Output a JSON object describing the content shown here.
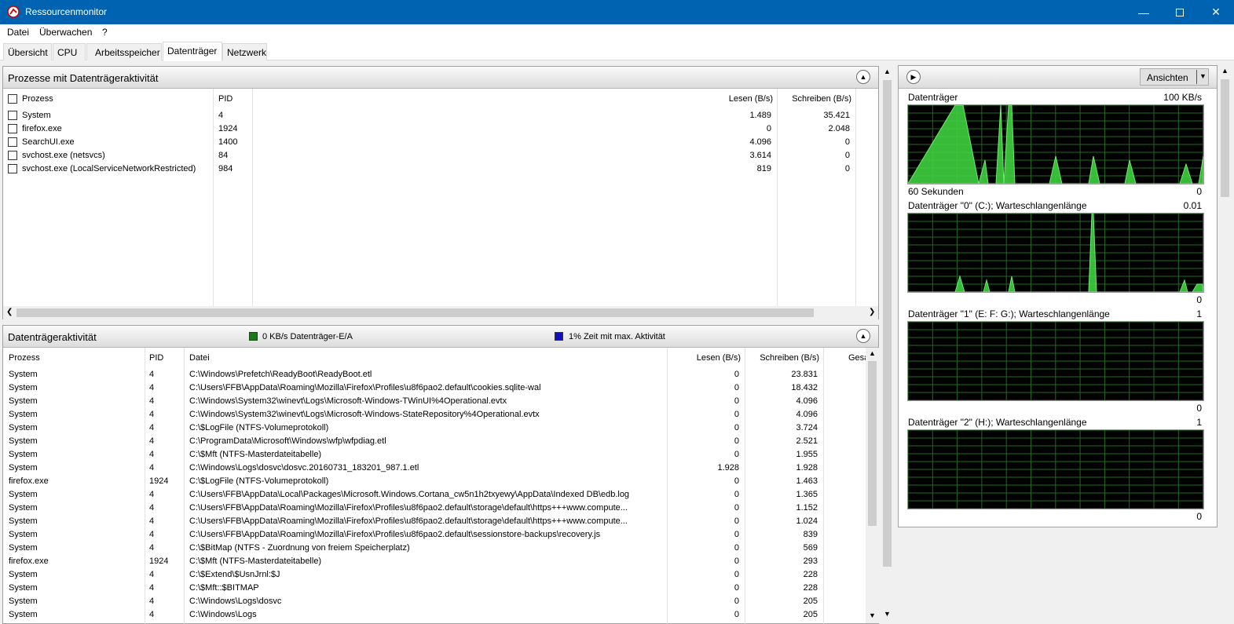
{
  "window": {
    "title": "Ressourcenmonitor"
  },
  "menu": {
    "file": "Datei",
    "monitor": "Überwachen",
    "help": "?"
  },
  "tabs": [
    {
      "label": "Übersicht"
    },
    {
      "label": "CPU"
    },
    {
      "label": "Arbeitsspeicher"
    },
    {
      "label": "Datenträger",
      "active": true
    },
    {
      "label": "Netzwerk"
    }
  ],
  "processes_panel": {
    "title": "Prozesse mit Datenträgeraktivität",
    "columns": [
      "Prozess",
      "PID",
      "Lesen (B/s)",
      "Schreiben (B/s)"
    ],
    "rows": [
      {
        "name": "System",
        "pid": "4",
        "read": "1.489",
        "write": "35.421"
      },
      {
        "name": "firefox.exe",
        "pid": "1924",
        "read": "0",
        "write": "2.048"
      },
      {
        "name": "SearchUI.exe",
        "pid": "1400",
        "read": "4.096",
        "write": "0"
      },
      {
        "name": "svchost.exe (netsvcs)",
        "pid": "84",
        "read": "3.614",
        "write": "0"
      },
      {
        "name": "svchost.exe (LocalServiceNetworkRestricted)",
        "pid": "984",
        "read": "819",
        "write": "0"
      }
    ]
  },
  "activity_panel": {
    "title": "Datenträgeraktivität",
    "legend_io": "0 KB/s Datenträger-E/A",
    "legend_time": "1% Zeit mit max. Aktivität",
    "io_color": "#1a7a1a",
    "time_color": "#1010c0",
    "columns": [
      "Prozess",
      "PID",
      "Datei",
      "Lesen (B/s)",
      "Schreiben (B/s)",
      "Gesa"
    ],
    "rows": [
      {
        "name": "System",
        "pid": "4",
        "file": "C:\\Windows\\Prefetch\\ReadyBoot\\ReadyBoot.etl",
        "read": "0",
        "write": "23.831"
      },
      {
        "name": "System",
        "pid": "4",
        "file": "C:\\Users\\FFB\\AppData\\Roaming\\Mozilla\\Firefox\\Profiles\\u8f6pao2.default\\cookies.sqlite-wal",
        "read": "0",
        "write": "18.432"
      },
      {
        "name": "System",
        "pid": "4",
        "file": "C:\\Windows\\System32\\winevt\\Logs\\Microsoft-Windows-TWinUI%4Operational.evtx",
        "read": "0",
        "write": "4.096"
      },
      {
        "name": "System",
        "pid": "4",
        "file": "C:\\Windows\\System32\\winevt\\Logs\\Microsoft-Windows-StateRepository%4Operational.evtx",
        "read": "0",
        "write": "4.096"
      },
      {
        "name": "System",
        "pid": "4",
        "file": "C:\\$LogFile (NTFS-Volumeprotokoll)",
        "read": "0",
        "write": "3.724"
      },
      {
        "name": "System",
        "pid": "4",
        "file": "C:\\ProgramData\\Microsoft\\Windows\\wfp\\wfpdiag.etl",
        "read": "0",
        "write": "2.521"
      },
      {
        "name": "System",
        "pid": "4",
        "file": "C:\\$Mft (NTFS-Masterdateitabelle)",
        "read": "0",
        "write": "1.955"
      },
      {
        "name": "System",
        "pid": "4",
        "file": "C:\\Windows\\Logs\\dosvc\\dosvc.20160731_183201_987.1.etl",
        "read": "1.928",
        "write": "1.928"
      },
      {
        "name": "firefox.exe",
        "pid": "1924",
        "file": "C:\\$LogFile (NTFS-Volumeprotokoll)",
        "read": "0",
        "write": "1.463"
      },
      {
        "name": "System",
        "pid": "4",
        "file": "C:\\Users\\FFB\\AppData\\Local\\Packages\\Microsoft.Windows.Cortana_cw5n1h2txyewy\\AppData\\Indexed DB\\edb.log",
        "read": "0",
        "write": "1.365"
      },
      {
        "name": "System",
        "pid": "4",
        "file": "C:\\Users\\FFB\\AppData\\Roaming\\Mozilla\\Firefox\\Profiles\\u8f6pao2.default\\storage\\default\\https+++www.compute...",
        "read": "0",
        "write": "1.152"
      },
      {
        "name": "System",
        "pid": "4",
        "file": "C:\\Users\\FFB\\AppData\\Roaming\\Mozilla\\Firefox\\Profiles\\u8f6pao2.default\\storage\\default\\https+++www.compute...",
        "read": "0",
        "write": "1.024"
      },
      {
        "name": "System",
        "pid": "4",
        "file": "C:\\Users\\FFB\\AppData\\Roaming\\Mozilla\\Firefox\\Profiles\\u8f6pao2.default\\sessionstore-backups\\recovery.js",
        "read": "0",
        "write": "839"
      },
      {
        "name": "System",
        "pid": "4",
        "file": "C:\\$BitMap (NTFS - Zuordnung von freiem Speicherplatz)",
        "read": "0",
        "write": "569"
      },
      {
        "name": "firefox.exe",
        "pid": "1924",
        "file": "C:\\$Mft (NTFS-Masterdateitabelle)",
        "read": "0",
        "write": "293"
      },
      {
        "name": "System",
        "pid": "4",
        "file": "C:\\$Extend\\$UsnJrnl:$J",
        "read": "0",
        "write": "228"
      },
      {
        "name": "System",
        "pid": "4",
        "file": "C:\\$Mft::$BITMAP",
        "read": "0",
        "write": "228"
      },
      {
        "name": "System",
        "pid": "4",
        "file": "C:\\Windows\\Logs\\dosvc",
        "read": "0",
        "write": "205"
      },
      {
        "name": "System",
        "pid": "4",
        "file": "C:\\Windows\\Logs",
        "read": "0",
        "write": "205"
      }
    ]
  },
  "graphs_panel": {
    "views_button": "Ansichten",
    "graphs": [
      {
        "title": "Datenträger",
        "max": "100 KB/s",
        "bottom_left": "60 Sekunden",
        "min": "0"
      },
      {
        "title": "Datenträger \"0\" (C:); Warteschlangenlänge",
        "max": "0.01",
        "bottom_left": "",
        "min": "0"
      },
      {
        "title": "Datenträger \"1\" (E: F: G:); Warteschlangenlänge",
        "max": "1",
        "bottom_left": "",
        "min": "0"
      },
      {
        "title": "Datenträger \"2\" (H:); Warteschlangenlänge",
        "max": "1",
        "bottom_left": "",
        "min": "0"
      }
    ]
  }
}
